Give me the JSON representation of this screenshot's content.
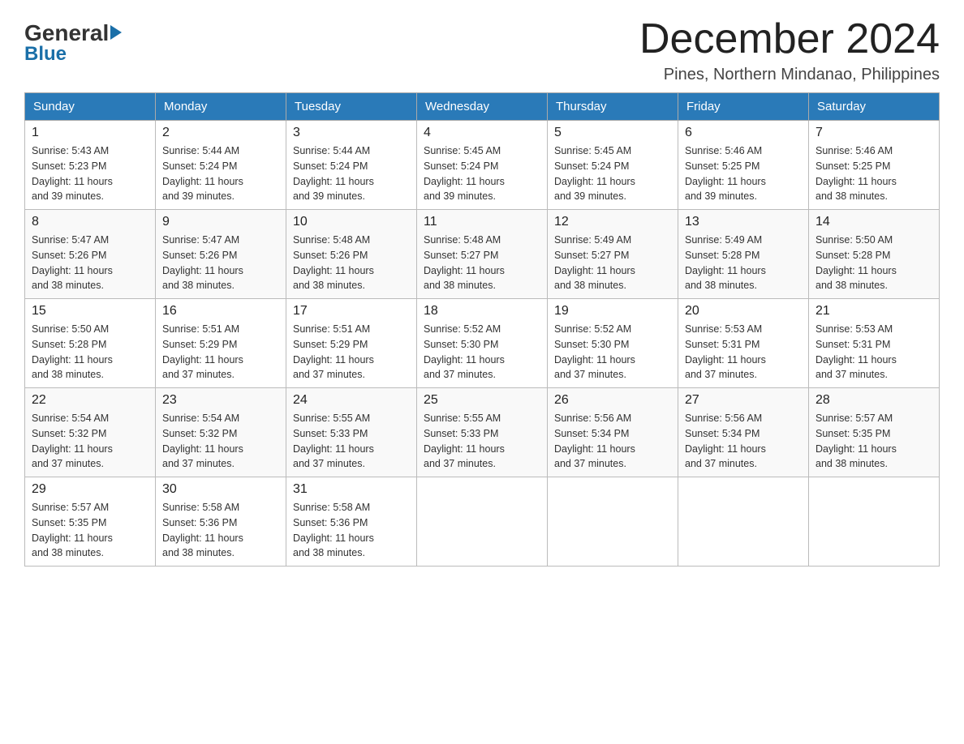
{
  "header": {
    "logo_general": "General",
    "logo_blue": "Blue",
    "month_title": "December 2024",
    "location": "Pines, Northern Mindanao, Philippines"
  },
  "days_of_week": [
    "Sunday",
    "Monday",
    "Tuesday",
    "Wednesday",
    "Thursday",
    "Friday",
    "Saturday"
  ],
  "weeks": [
    [
      {
        "day": "1",
        "sunrise": "5:43 AM",
        "sunset": "5:23 PM",
        "daylight": "11 hours and 39 minutes."
      },
      {
        "day": "2",
        "sunrise": "5:44 AM",
        "sunset": "5:24 PM",
        "daylight": "11 hours and 39 minutes."
      },
      {
        "day": "3",
        "sunrise": "5:44 AM",
        "sunset": "5:24 PM",
        "daylight": "11 hours and 39 minutes."
      },
      {
        "day": "4",
        "sunrise": "5:45 AM",
        "sunset": "5:24 PM",
        "daylight": "11 hours and 39 minutes."
      },
      {
        "day": "5",
        "sunrise": "5:45 AM",
        "sunset": "5:24 PM",
        "daylight": "11 hours and 39 minutes."
      },
      {
        "day": "6",
        "sunrise": "5:46 AM",
        "sunset": "5:25 PM",
        "daylight": "11 hours and 39 minutes."
      },
      {
        "day": "7",
        "sunrise": "5:46 AM",
        "sunset": "5:25 PM",
        "daylight": "11 hours and 38 minutes."
      }
    ],
    [
      {
        "day": "8",
        "sunrise": "5:47 AM",
        "sunset": "5:26 PM",
        "daylight": "11 hours and 38 minutes."
      },
      {
        "day": "9",
        "sunrise": "5:47 AM",
        "sunset": "5:26 PM",
        "daylight": "11 hours and 38 minutes."
      },
      {
        "day": "10",
        "sunrise": "5:48 AM",
        "sunset": "5:26 PM",
        "daylight": "11 hours and 38 minutes."
      },
      {
        "day": "11",
        "sunrise": "5:48 AM",
        "sunset": "5:27 PM",
        "daylight": "11 hours and 38 minutes."
      },
      {
        "day": "12",
        "sunrise": "5:49 AM",
        "sunset": "5:27 PM",
        "daylight": "11 hours and 38 minutes."
      },
      {
        "day": "13",
        "sunrise": "5:49 AM",
        "sunset": "5:28 PM",
        "daylight": "11 hours and 38 minutes."
      },
      {
        "day": "14",
        "sunrise": "5:50 AM",
        "sunset": "5:28 PM",
        "daylight": "11 hours and 38 minutes."
      }
    ],
    [
      {
        "day": "15",
        "sunrise": "5:50 AM",
        "sunset": "5:28 PM",
        "daylight": "11 hours and 38 minutes."
      },
      {
        "day": "16",
        "sunrise": "5:51 AM",
        "sunset": "5:29 PM",
        "daylight": "11 hours and 37 minutes."
      },
      {
        "day": "17",
        "sunrise": "5:51 AM",
        "sunset": "5:29 PM",
        "daylight": "11 hours and 37 minutes."
      },
      {
        "day": "18",
        "sunrise": "5:52 AM",
        "sunset": "5:30 PM",
        "daylight": "11 hours and 37 minutes."
      },
      {
        "day": "19",
        "sunrise": "5:52 AM",
        "sunset": "5:30 PM",
        "daylight": "11 hours and 37 minutes."
      },
      {
        "day": "20",
        "sunrise": "5:53 AM",
        "sunset": "5:31 PM",
        "daylight": "11 hours and 37 minutes."
      },
      {
        "day": "21",
        "sunrise": "5:53 AM",
        "sunset": "5:31 PM",
        "daylight": "11 hours and 37 minutes."
      }
    ],
    [
      {
        "day": "22",
        "sunrise": "5:54 AM",
        "sunset": "5:32 PM",
        "daylight": "11 hours and 37 minutes."
      },
      {
        "day": "23",
        "sunrise": "5:54 AM",
        "sunset": "5:32 PM",
        "daylight": "11 hours and 37 minutes."
      },
      {
        "day": "24",
        "sunrise": "5:55 AM",
        "sunset": "5:33 PM",
        "daylight": "11 hours and 37 minutes."
      },
      {
        "day": "25",
        "sunrise": "5:55 AM",
        "sunset": "5:33 PM",
        "daylight": "11 hours and 37 minutes."
      },
      {
        "day": "26",
        "sunrise": "5:56 AM",
        "sunset": "5:34 PM",
        "daylight": "11 hours and 37 minutes."
      },
      {
        "day": "27",
        "sunrise": "5:56 AM",
        "sunset": "5:34 PM",
        "daylight": "11 hours and 37 minutes."
      },
      {
        "day": "28",
        "sunrise": "5:57 AM",
        "sunset": "5:35 PM",
        "daylight": "11 hours and 38 minutes."
      }
    ],
    [
      {
        "day": "29",
        "sunrise": "5:57 AM",
        "sunset": "5:35 PM",
        "daylight": "11 hours and 38 minutes."
      },
      {
        "day": "30",
        "sunrise": "5:58 AM",
        "sunset": "5:36 PM",
        "daylight": "11 hours and 38 minutes."
      },
      {
        "day": "31",
        "sunrise": "5:58 AM",
        "sunset": "5:36 PM",
        "daylight": "11 hours and 38 minutes."
      },
      null,
      null,
      null,
      null
    ]
  ],
  "labels": {
    "sunrise": "Sunrise:",
    "sunset": "Sunset:",
    "daylight": "Daylight:"
  }
}
